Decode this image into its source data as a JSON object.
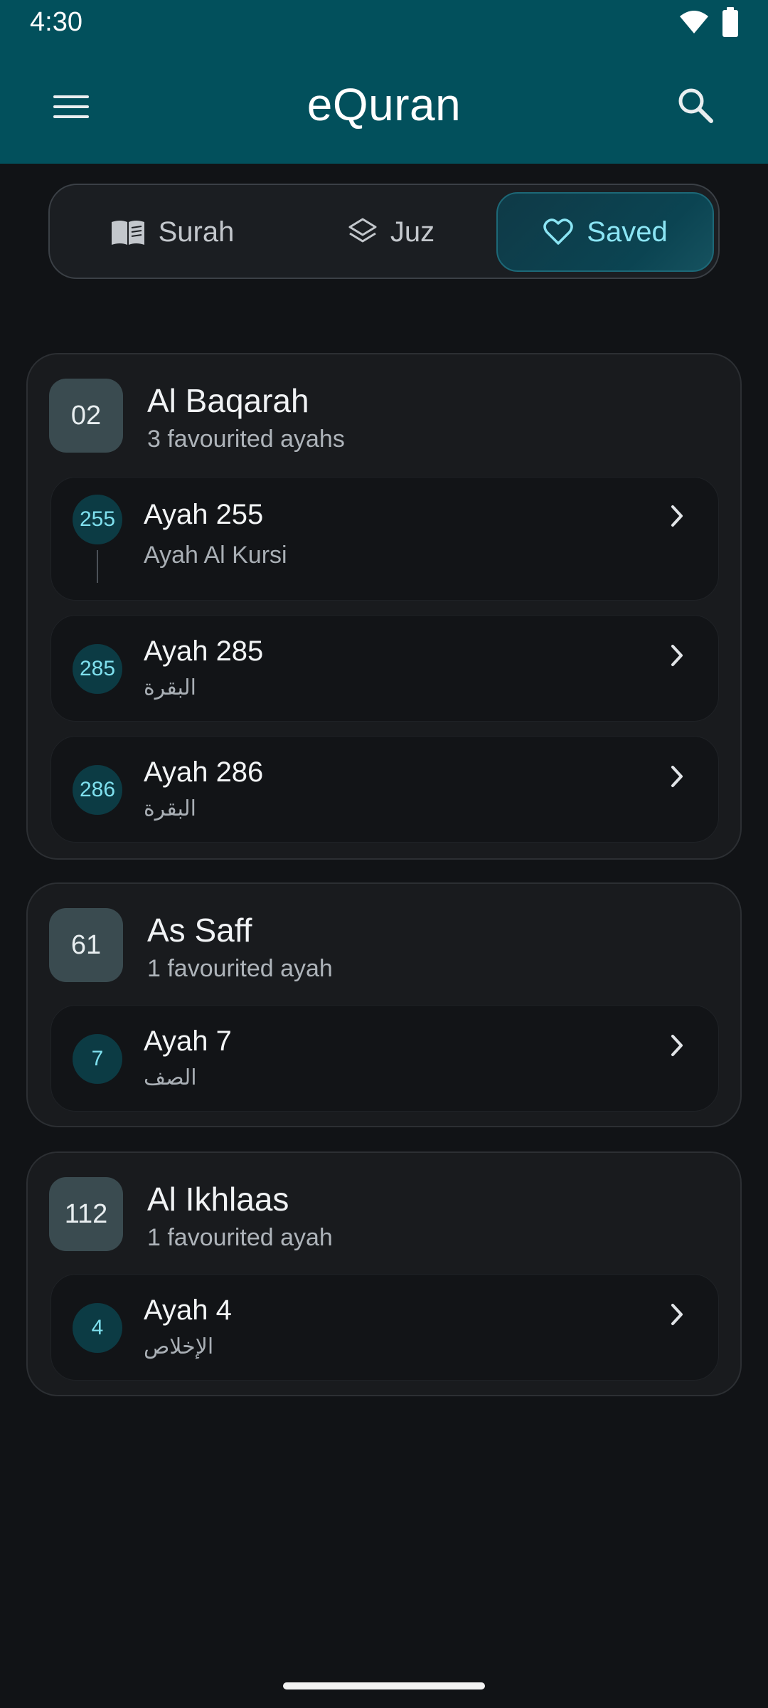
{
  "status": {
    "time": "4:30"
  },
  "appbar": {
    "title": "eQuran"
  },
  "tabs": [
    {
      "label": "Surah",
      "icon": "book-icon"
    },
    {
      "label": "Juz",
      "icon": "layers-icon"
    },
    {
      "label": "Saved",
      "icon": "heart-icon",
      "selected": true
    }
  ],
  "groups": [
    {
      "number": "02",
      "name": "Al Baqarah",
      "count_label": "3 favourited ayahs",
      "ayahs": [
        {
          "num": "255",
          "title": "Ayah 255",
          "sub": "Ayah Al Kursi"
        },
        {
          "num": "285",
          "title": "Ayah 285",
          "sub": "البقرة"
        },
        {
          "num": "286",
          "title": "Ayah 286",
          "sub": "البقرة"
        }
      ]
    },
    {
      "number": "61",
      "name": "As Saff",
      "count_label": "1 favourited ayah",
      "ayahs": [
        {
          "num": "7",
          "title": "Ayah 7",
          "sub": "الصف"
        }
      ]
    },
    {
      "number": "112",
      "name": "Al Ikhlaas",
      "count_label": "1 favourited ayah",
      "ayahs": [
        {
          "num": "4",
          "title": "Ayah 4",
          "sub": "الإخلاص"
        }
      ]
    }
  ],
  "colors": {
    "appbar": "#02505c",
    "background": "#111316",
    "accent": "#8be5f4"
  }
}
